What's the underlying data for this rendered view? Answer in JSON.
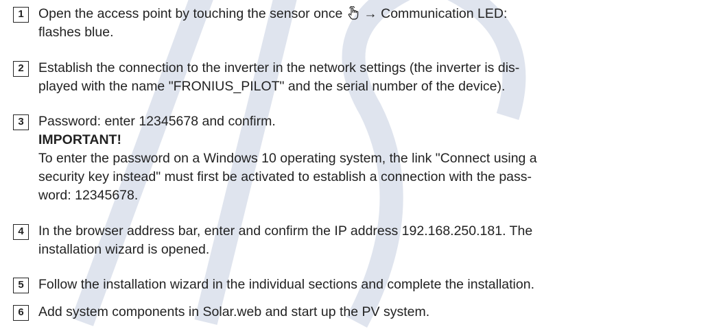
{
  "watermark": {
    "color": "#dfe4ee"
  },
  "steps": [
    {
      "number": "1",
      "lines": [
        "Open the access point by touching the sensor once",
        "flashes blue."
      ],
      "after_icon": " → Communication LED:",
      "icon": "hand-touch-icon"
    },
    {
      "number": "2",
      "lines": [
        "Establish the connection to the inverter in the network settings (the inverter is dis-",
        "played with the name \"FRONIUS_PILOT\" and the serial number of the device)."
      ]
    },
    {
      "number": "3",
      "lines": [
        "Password: enter 12345678 and confirm.",
        "IMPORTANT!",
        "To enter the password on a Windows 10 operating system, the link \"Connect using a",
        "security key instead\" must first be activated to establish a connection with the pass-",
        "word: 12345678."
      ]
    },
    {
      "number": "4",
      "lines": [
        "In the browser address bar, enter and confirm the IP address 192.168.250.181. The",
        "installation wizard is opened."
      ]
    },
    {
      "number": "5",
      "lines": [
        "Follow the installation wizard in the individual sections and complete the installation."
      ]
    },
    {
      "number": "6",
      "lines": [
        "Add system components in Solar.web and start up the PV system."
      ]
    }
  ]
}
